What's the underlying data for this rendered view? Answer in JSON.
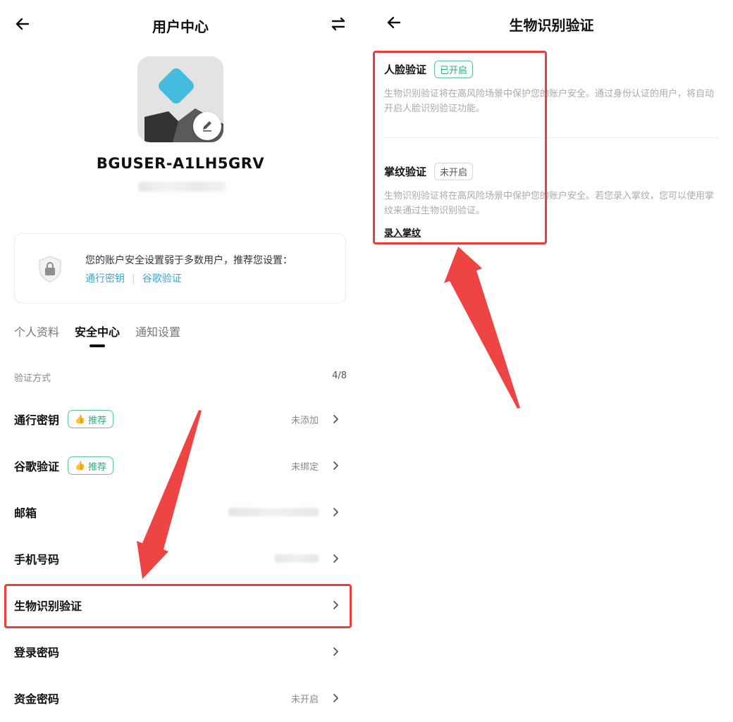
{
  "left": {
    "header": {
      "title": "用户中心"
    },
    "profile": {
      "username": "BGUSER-A1LH5GRV"
    },
    "security_card": {
      "message": "您的账户安全设置弱于多数用户，推荐您设置：",
      "links": [
        "通行密钥",
        "谷歌验证"
      ]
    },
    "tabs": [
      {
        "label": "个人资料",
        "active": false
      },
      {
        "label": "安全中心",
        "active": true
      },
      {
        "label": "通知设置",
        "active": false
      }
    ],
    "section": {
      "title": "验证方式",
      "count": "4/8"
    },
    "rows": [
      {
        "label": "通行密钥",
        "badge": "推荐",
        "status": "未添加"
      },
      {
        "label": "谷歌验证",
        "badge": "推荐",
        "status": "未绑定"
      },
      {
        "label": "邮箱",
        "badge": "",
        "status": ""
      },
      {
        "label": "手机号码",
        "badge": "",
        "status": ""
      },
      {
        "label": "生物识别验证",
        "badge": "",
        "status": ""
      },
      {
        "label": "登录密码",
        "badge": "",
        "status": ""
      },
      {
        "label": "资金密码",
        "badge": "",
        "status": "未开启"
      }
    ]
  },
  "right": {
    "header": {
      "title": "生物识别验证"
    },
    "face": {
      "title": "人脸验证",
      "badge": "已开启",
      "desc": "生物识别验证将在高风险场景中保护您的账户安全。通过身份认证的用户，将自动开启人脸识别验证功能。"
    },
    "palm": {
      "title": "掌纹验证",
      "badge": "未开启",
      "desc": "生物识别验证将在高风险场景中保护您的账户安全。若您录入掌纹，您可以使用掌纹来通过生物识别验证。",
      "link": "录入掌纹"
    }
  },
  "colors": {
    "accent_green": "#2dae7a",
    "link_blue": "#3ba7c9",
    "highlight_red": "#ec3d3d",
    "logo_cyan": "#44bce0"
  },
  "icons": [
    "back-arrow-icon",
    "switch-icon",
    "edit-icon",
    "shield-lock-icon",
    "thumbs-up-icon",
    "chevron-right-icon"
  ]
}
